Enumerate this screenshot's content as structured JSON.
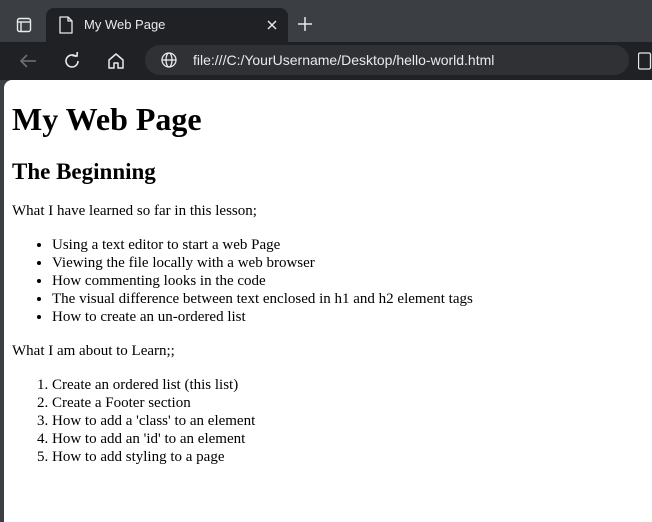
{
  "browser": {
    "tab_title": "My Web Page",
    "url": "file:///C:/YourUsername/Desktop/hello-world.html"
  },
  "page": {
    "h1": "My Web Page",
    "h2": "The Beginning",
    "intro": "What I have learned so far in this lesson;",
    "learned_items": [
      "Using a text editor to start a web Page",
      "Viewing the file locally with a web browser",
      "How commenting looks in the code",
      "The visual difference between text enclosed in h1 and h2 element tags",
      "How to create an un-ordered list"
    ],
    "about": "What I am about to Learn;;",
    "to_learn_items": [
      "Create an ordered list (this list)",
      "Create a Footer section",
      "How to add a 'class' to an element",
      "How to add an 'id' to an element",
      "How to add styling to a page"
    ]
  }
}
